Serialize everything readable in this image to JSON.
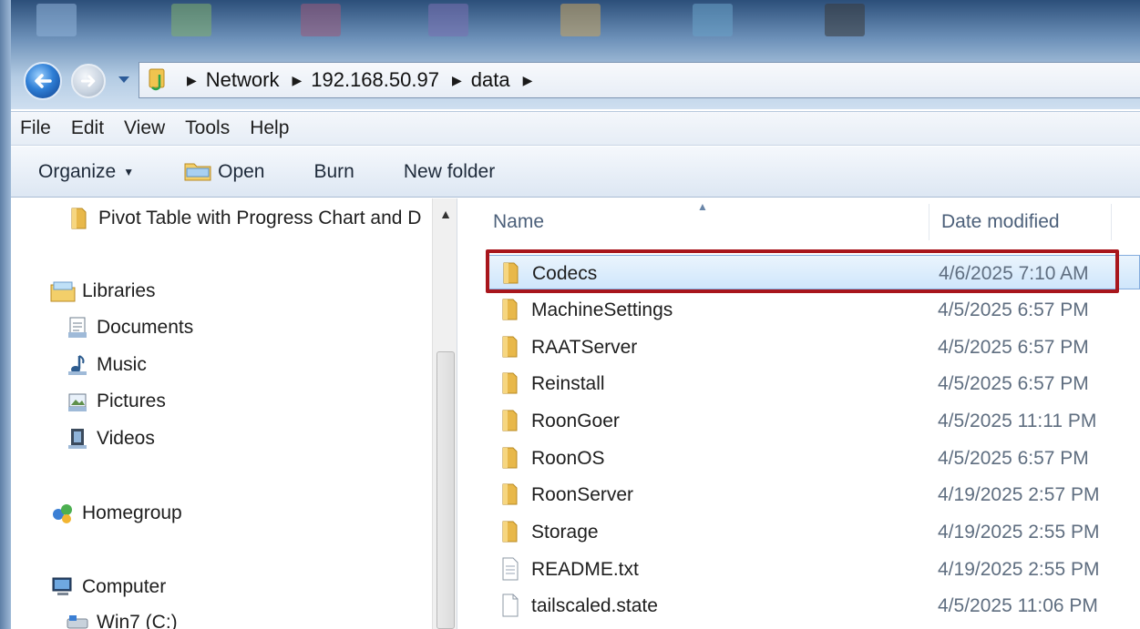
{
  "address": {
    "crumbs": [
      "Network",
      "192.168.50.97",
      "data"
    ]
  },
  "menu": [
    "File",
    "Edit",
    "View",
    "Tools",
    "Help"
  ],
  "commands": {
    "organize": "Organize",
    "open": "Open",
    "burn": "Burn",
    "new_folder": "New folder"
  },
  "nav": {
    "pinned_folder": "Pivot Table with Progress Chart and D",
    "libraries": "Libraries",
    "documents": "Documents",
    "music": "Music",
    "pictures": "Pictures",
    "videos": "Videos",
    "homegroup": "Homegroup",
    "computer": "Computer",
    "drive": "Win7 (C:)"
  },
  "columns": {
    "name": "Name",
    "date": "Date modified"
  },
  "files": [
    {
      "name": "Codecs",
      "date": "4/6/2025 7:10 AM",
      "type": "folder",
      "selected": true
    },
    {
      "name": "MachineSettings",
      "date": "4/5/2025 6:57 PM",
      "type": "folder"
    },
    {
      "name": "RAATServer",
      "date": "4/5/2025 6:57 PM",
      "type": "folder"
    },
    {
      "name": "Reinstall",
      "date": "4/5/2025 6:57 PM",
      "type": "folder"
    },
    {
      "name": "RoonGoer",
      "date": "4/5/2025 11:11 PM",
      "type": "folder"
    },
    {
      "name": "RoonOS",
      "date": "4/5/2025 6:57 PM",
      "type": "folder"
    },
    {
      "name": "RoonServer",
      "date": "4/19/2025 2:57 PM",
      "type": "folder"
    },
    {
      "name": "Storage",
      "date": "4/19/2025 2:55 PM",
      "type": "folder"
    },
    {
      "name": "README.txt",
      "date": "4/19/2025 2:55 PM",
      "type": "text-file"
    },
    {
      "name": "tailscaled.state",
      "date": "4/5/2025 11:06 PM",
      "type": "file"
    }
  ],
  "colors": {
    "highlight": "#a8161c",
    "selection": "#cfe6fb",
    "folder": "#e8b84a"
  }
}
